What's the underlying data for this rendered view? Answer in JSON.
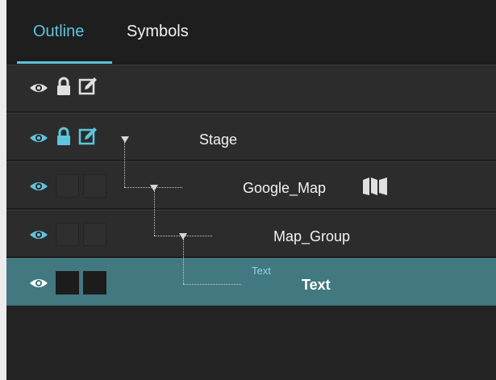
{
  "tabs": [
    {
      "label": "Outline",
      "active": true
    },
    {
      "label": "Symbols",
      "active": false
    }
  ],
  "outline": {
    "rows": [
      {
        "label": "",
        "visible": true,
        "locked": true,
        "editable": true
      },
      {
        "label": "Stage",
        "visible": true,
        "locked": true,
        "editable": true,
        "expanded": true
      },
      {
        "label": "Google_Map",
        "visible": true,
        "locked": false,
        "editable": false,
        "expanded": true,
        "badge_icon": "map-icon"
      },
      {
        "label": "Map_Group",
        "visible": true,
        "locked": false,
        "editable": false,
        "expanded": true
      },
      {
        "label": "Text",
        "visible": true,
        "locked": false,
        "editable": false,
        "selected": true,
        "type_hint": "Text"
      }
    ]
  },
  "colors": {
    "accent": "#5ec4dd",
    "selected_row": "#42787f",
    "panel_bg": "#232323"
  }
}
